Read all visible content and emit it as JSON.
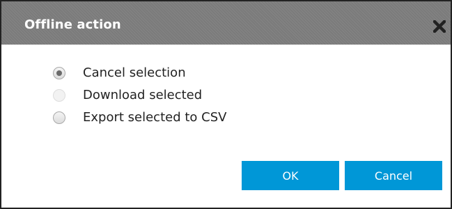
{
  "dialog": {
    "title": "Offline action",
    "close_icon": "close-x-icon"
  },
  "options": [
    {
      "label": "Cancel selection",
      "checked": true,
      "disabled": false
    },
    {
      "label": "Download selected",
      "checked": false,
      "disabled": true
    },
    {
      "label": "Export selected to CSV",
      "checked": false,
      "disabled": false
    }
  ],
  "buttons": {
    "ok_label": "OK",
    "cancel_label": "Cancel"
  },
  "colors": {
    "titlebar": "#7b7b7b",
    "accent": "#0097d7",
    "border": "#222222"
  }
}
